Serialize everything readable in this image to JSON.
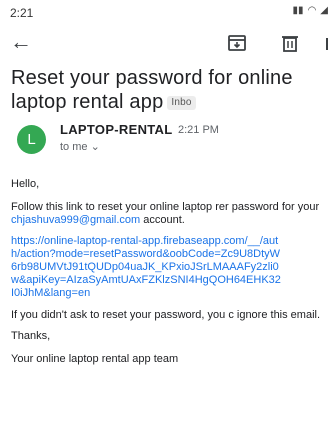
{
  "status_bar": {
    "time": "2:21",
    "icons": [
      "signal-icon",
      "wifi-icon",
      "network-icon"
    ]
  },
  "app_bar": {
    "back_icon": "arrow-left-icon",
    "archive_icon": "archive-icon",
    "delete_icon": "trash-icon"
  },
  "email": {
    "subject": "Reset your password for online laptop rental app",
    "label": "Inbo",
    "sender": {
      "avatar_letter": "L",
      "name": "LAPTOP-RENTAL",
      "time": "2:21 PM",
      "recipient": "to me ⌄",
      "avatar_color": "#34a853"
    },
    "body": {
      "greeting": "Hello,",
      "instructions_prefix": "Follow this link to reset your online laptop rer password for your ",
      "email_address": "chjashuva999@gmail.com",
      "instructions_suffix": " account.",
      "link": "https://online-laptop-rental-app.firebaseapp.com/__/auth/action?mode=resetPassword&oobCode=Zc9U8DtyW6rb98UMVtJ91tQUDp04uaJK_KPxioJSrLMAAAFy2zli0w&apiKey=AIzaSyAmtUAxFZKlzSNI4HgQOH64EHK32I0iJhM&lang=en",
      "ignore_note": "If you didn't ask to reset your password, you c ignore this email.",
      "thanks": "Thanks,",
      "signature": "Your online laptop rental app team"
    }
  },
  "colors": {
    "link": "#1a73e8",
    "text": "#202124",
    "muted": "#5f6368"
  }
}
